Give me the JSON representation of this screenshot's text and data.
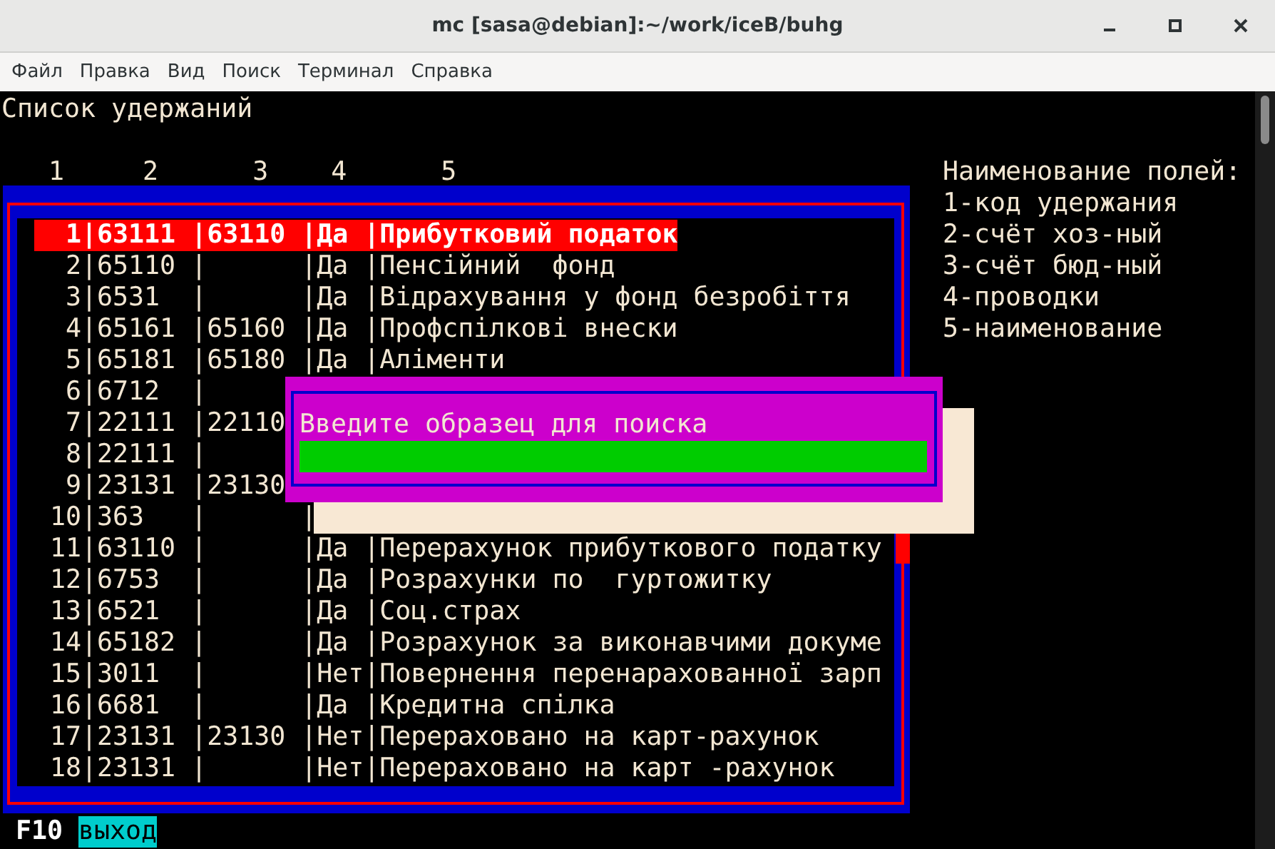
{
  "window": {
    "title": "mc [sasa@debian]:~/work/iceB/buhg"
  },
  "menu": [
    "Файл",
    "Правка",
    "Вид",
    "Поиск",
    "Терминал",
    "Справка"
  ],
  "screen_title": "Список удержаний",
  "column_numbers": "   1     2      3    4      5",
  "legend": [
    "Наименование полей:",
    "1-код удержания",
    "2-счёт хоз-ный",
    "3-счёт бюд-ный",
    "4-проводки",
    "5-наименование"
  ],
  "rows": [
    {
      "text": "  1|63111 |63110 |Да |Прибутковий податок",
      "selected": true
    },
    {
      "text": "  2|65110 |      |Да |Пенсійний  фонд",
      "selected": false
    },
    {
      "text": "  3|6531  |      |Да |Відрахування у фонд безробіття",
      "selected": false
    },
    {
      "text": "  4|65161 |65160 |Да |Профспілкові внески",
      "selected": false
    },
    {
      "text": "  5|65181 |65180 |Да |Аліменти",
      "selected": false
    },
    {
      "text": "  6|6712  |",
      "selected": false
    },
    {
      "text": "  7|22111 |22110",
      "selected": false
    },
    {
      "text": "  8|22111 |",
      "selected": false
    },
    {
      "text": "  9|23131 |23130",
      "selected": false
    },
    {
      "text": " 10|363   |      |",
      "selected": false
    },
    {
      "text": " 11|63110 |      |Да |Перерахунок прибуткового податку",
      "selected": false
    },
    {
      "text": " 12|6753  |      |Да |Розрахунки по  гуртожитку",
      "selected": false
    },
    {
      "text": " 13|6521  |      |Да |Соц.страх",
      "selected": false
    },
    {
      "text": " 14|65182 |      |Да |Розрахунок за виконавчими докуме",
      "selected": false
    },
    {
      "text": " 15|3011  |      |Нет|Повернення перенарахованної зарп",
      "selected": false
    },
    {
      "text": " 16|6681  |      |Да |Кредитна спілка",
      "selected": false
    },
    {
      "text": " 17|23131 |23130 |Нет|Перераховано на карт-рахунок",
      "selected": false
    },
    {
      "text": " 18|23131 |      |Нет|Перераховано на карт -рахунок",
      "selected": false
    }
  ],
  "search_dialog": {
    "prompt": "Введите образец для поиска"
  },
  "key_hints": [
    {
      "key": "F10",
      "action": "выход"
    }
  ]
}
